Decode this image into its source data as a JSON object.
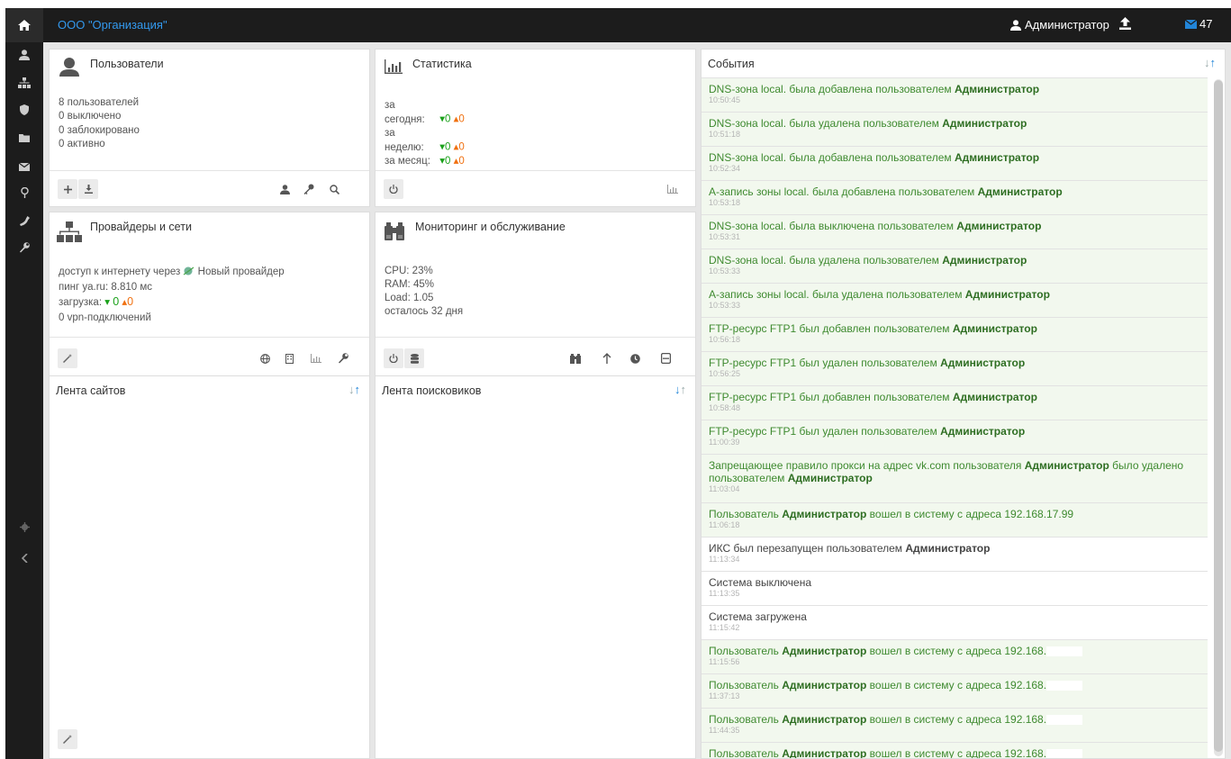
{
  "header": {
    "org_name": "ООО \"Организация\"",
    "user_name": "Администратор",
    "mail_count": "47"
  },
  "users_panel": {
    "title": "Пользователи",
    "lines": [
      "8 пользователей",
      "0 выключено",
      "0 заблокировано",
      "0 активно"
    ]
  },
  "stats_panel": {
    "title": "Статистика",
    "rows": [
      {
        "label": "за сегодня:",
        "down": "0",
        "up": "0"
      },
      {
        "label": "за неделю:",
        "down": "0",
        "up": "0"
      },
      {
        "label": "за месяц:",
        "down": "0",
        "up": "0"
      }
    ]
  },
  "providers_panel": {
    "title": "Провайдеры и сети",
    "access_prefix": "доступ к интернету через",
    "provider_name": "Новый провайдер",
    "ping": "пинг ya.ru: 8.810 мс",
    "load_label": "загрузка:",
    "load_down": "0",
    "load_up": "0",
    "vpn": "0 vpn-подключений"
  },
  "monitoring_panel": {
    "title": "Мониторинг и обслуживание",
    "lines": [
      "CPU: 23%",
      "RAM: 45%",
      "Load: 1.05",
      "осталось 32 дня"
    ]
  },
  "sites_feed": {
    "title": "Лента сайтов"
  },
  "search_feed": {
    "title": "Лента поисковиков"
  },
  "events": {
    "title": "События",
    "items": [
      {
        "pre": "DNS-зона local. была добавлена пользователем ",
        "bold": "Администратор",
        "post": "",
        "time": "10:50:45",
        "color": "green"
      },
      {
        "pre": "DNS-зона local. была удалена пользователем ",
        "bold": "Администратор",
        "post": "",
        "time": "10:51:18",
        "color": "green"
      },
      {
        "pre": "DNS-зона local. была добавлена пользователем ",
        "bold": "Администратор",
        "post": "",
        "time": "10:52:34",
        "color": "green"
      },
      {
        "pre": "А-запись зоны local. была добавлена пользователем ",
        "bold": "Администратор",
        "post": "",
        "time": "10:53:18",
        "color": "green"
      },
      {
        "pre": "DNS-зона local. была выключена пользователем ",
        "bold": "Администратор",
        "post": "",
        "time": "10:53:31",
        "color": "green"
      },
      {
        "pre": "DNS-зона local. была удалена пользователем ",
        "bold": "Администратор",
        "post": "",
        "time": "10:53:33",
        "color": "green"
      },
      {
        "pre": "А-запись зоны local. была удалена пользователем ",
        "bold": "Администратор",
        "post": "",
        "time": "10:53:33",
        "color": "green"
      },
      {
        "pre": "FTP-ресурс FTP1 был добавлен пользователем ",
        "bold": "Администратор",
        "post": "",
        "time": "10:56:18",
        "color": "green"
      },
      {
        "pre": "FTP-ресурс FTP1 был удален пользователем ",
        "bold": "Администратор",
        "post": "",
        "time": "10:56:25",
        "color": "green"
      },
      {
        "pre": "FTP-ресурс FTP1 был добавлен пользователем ",
        "bold": "Администратор",
        "post": "",
        "time": "10:58:48",
        "color": "green"
      },
      {
        "pre": "FTP-ресурс FTP1 был удален пользователем ",
        "bold": "Администратор",
        "post": "",
        "time": "11:00:39",
        "color": "green"
      },
      {
        "pre": "Запрещающее правило прокси на адрес vk.com пользователя ",
        "bold": "Администратор",
        "post": " было удалено пользователем ",
        "bold2": "Администратор",
        "time": "11:03:04",
        "color": "green",
        "tall": true
      },
      {
        "pre": "Пользователь ",
        "bold": "Администратор",
        "post": " вошел в систему с адреса 192.168.17.99",
        "time": "11:06:18",
        "color": "green"
      },
      {
        "pre": "ИКС был перезапущен пользователем ",
        "bold": "Администратор",
        "post": "",
        "time": "11:13:34",
        "color": "white"
      },
      {
        "pre": "Система выключена",
        "bold": "",
        "post": "",
        "time": "11:13:35",
        "color": "white"
      },
      {
        "pre": "Система загружена",
        "bold": "",
        "post": "",
        "time": "11:15:42",
        "color": "white"
      },
      {
        "pre": "Пользователь ",
        "bold": "Администратор",
        "post": " вошел в систему с адреса 192.168.",
        "time": "11:15:56",
        "color": "green",
        "masked": true
      },
      {
        "pre": "Пользователь ",
        "bold": "Администратор",
        "post": " вошел в систему с адреса 192.168.",
        "time": "11:37:13",
        "color": "green",
        "masked": true
      },
      {
        "pre": "Пользователь ",
        "bold": "Администратор",
        "post": " вошел в систему с адреса 192.168.",
        "time": "11:44:35",
        "color": "green",
        "masked": true
      },
      {
        "pre": "Пользователь ",
        "bold": "Администратор",
        "post": " вошел в систему с адреса 192.168.",
        "time": "",
        "color": "green",
        "masked": true
      }
    ]
  },
  "icons": {
    "sidebar": [
      "user-icon",
      "network-icon",
      "shield-icon",
      "folder-icon",
      "mail-icon",
      "map-pin-icon",
      "phone-icon",
      "wrench-icon",
      "gear-icon",
      "collapse-icon"
    ]
  },
  "colors": {
    "brand_link": "#3399ee",
    "event_green": "#3e8a2f",
    "down_arrow": "#1aa11a",
    "up_arrow": "#f07010"
  }
}
